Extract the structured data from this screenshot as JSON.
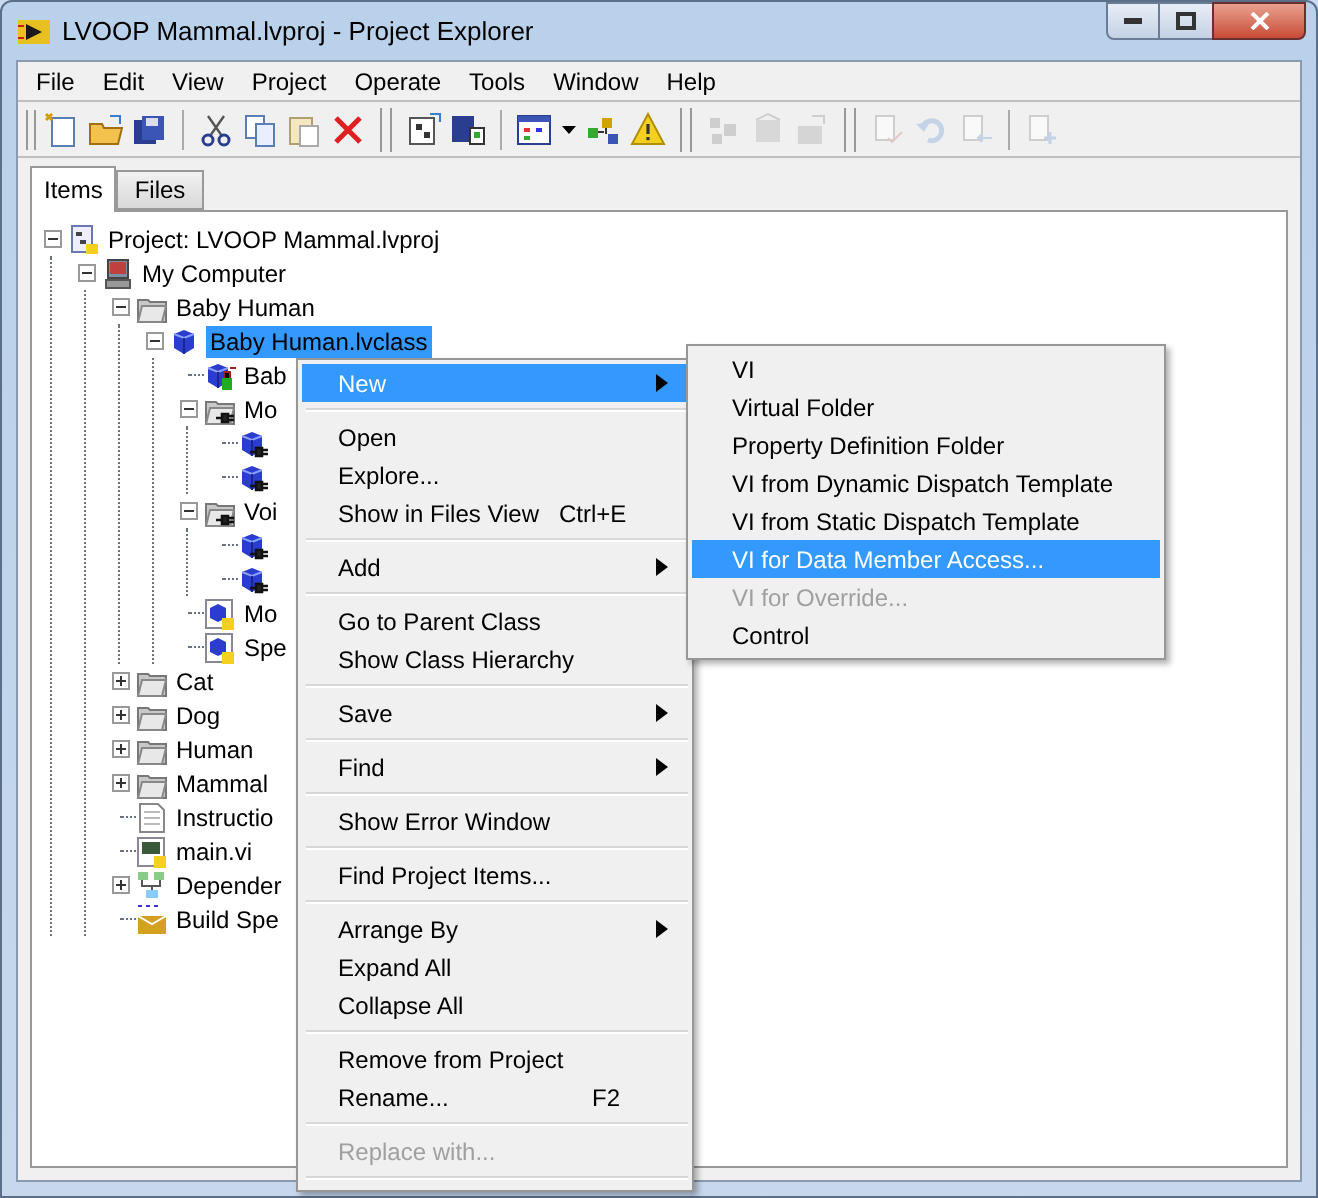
{
  "window": {
    "title": "LVOOP Mammal.lvproj - Project Explorer"
  },
  "menu_bar": [
    "File",
    "Edit",
    "View",
    "Project",
    "Operate",
    "Tools",
    "Window",
    "Help"
  ],
  "toolbar": [
    {
      "kind": "new",
      "disabled": false
    },
    {
      "kind": "open",
      "disabled": false
    },
    {
      "kind": "save-all",
      "disabled": false
    },
    {
      "kind": "separator"
    },
    {
      "kind": "cut",
      "disabled": false
    },
    {
      "kind": "copy",
      "disabled": false
    },
    {
      "kind": "paste",
      "disabled": false
    },
    {
      "kind": "delete",
      "disabled": false
    },
    {
      "kind": "group"
    },
    {
      "kind": "build",
      "disabled": false
    },
    {
      "kind": "save-build",
      "disabled": false
    },
    {
      "kind": "separator"
    },
    {
      "kind": "view",
      "disabled": false
    },
    {
      "kind": "dropdown",
      "disabled": false
    },
    {
      "kind": "hierarchy",
      "disabled": false
    },
    {
      "kind": "warning",
      "disabled": false
    },
    {
      "kind": "group"
    },
    {
      "kind": "source-control",
      "disabled": true
    },
    {
      "kind": "package",
      "disabled": true
    },
    {
      "kind": "package-out",
      "disabled": true
    },
    {
      "kind": "group"
    },
    {
      "kind": "check-in",
      "disabled": true
    },
    {
      "kind": "undo-checkout",
      "disabled": true
    },
    {
      "kind": "get",
      "disabled": true
    },
    {
      "kind": "separator"
    },
    {
      "kind": "add-file",
      "disabled": true
    }
  ],
  "tabs": [
    {
      "label": "Items",
      "selected": true
    },
    {
      "label": "Files",
      "selected": false
    }
  ],
  "tree": [
    {
      "kind": "project",
      "label": "Project: LVOOP Mammal.lvproj",
      "expanded": true,
      "selected": false,
      "children": [
        {
          "kind": "computer",
          "label": "My Computer",
          "expanded": true,
          "selected": false,
          "children": [
            {
              "kind": "folder",
              "label": "Baby Human",
              "expanded": true,
              "selected": false,
              "children": [
                {
                  "kind": "class",
                  "label": "Baby Human.lvclass",
                  "expanded": true,
                  "selected": true,
                  "children": [
                    {
                      "kind": "private-vi",
                      "label": "Bab",
                      "selected": false
                    },
                    {
                      "kind": "dispatch-folder",
                      "label": "Mo",
                      "expanded": true,
                      "selected": false,
                      "children": [
                        {
                          "kind": "dispatch-vi"
                        },
                        {
                          "kind": "dispatch-vi"
                        }
                      ]
                    },
                    {
                      "kind": "dispatch-folder",
                      "label": "Voi",
                      "expanded": true,
                      "selected": false,
                      "children": [
                        {
                          "kind": "dispatch-vi"
                        },
                        {
                          "kind": "dispatch-vi"
                        }
                      ]
                    },
                    {
                      "kind": "vi",
                      "label": "Mo",
                      "selected": false
                    },
                    {
                      "kind": "vi",
                      "label": "Spe",
                      "selected": false
                    }
                  ]
                }
              ]
            },
            {
              "kind": "folder",
              "label": "Cat",
              "expanded": false,
              "selected": false
            },
            {
              "kind": "folder",
              "label": "Dog",
              "expanded": false,
              "selected": false
            },
            {
              "kind": "folder",
              "label": "Human",
              "expanded": false,
              "selected": false
            },
            {
              "kind": "folder",
              "label": "Mammal",
              "expanded": false,
              "selected": false
            },
            {
              "kind": "text-file",
              "label": "Instructio",
              "selected": false
            },
            {
              "kind": "main-vi",
              "label": "main.vi",
              "selected": false
            },
            {
              "kind": "dependencies",
              "label": "Depender",
              "expanded": false,
              "selected": false
            },
            {
              "kind": "build",
              "label": "Build Spe",
              "selected": false
            }
          ]
        }
      ]
    }
  ],
  "context_menu": [
    {
      "kind": "item",
      "label": "New",
      "submenu": true,
      "selected": true,
      "disabled": false
    },
    {
      "kind": "separator"
    },
    {
      "kind": "item",
      "label": "Open",
      "selected": false,
      "disabled": false
    },
    {
      "kind": "item",
      "label": "Explore...",
      "selected": false,
      "disabled": false
    },
    {
      "kind": "item",
      "label": "Show in Files View",
      "shortcut": "Ctrl+E",
      "selected": false,
      "disabled": false
    },
    {
      "kind": "separator"
    },
    {
      "kind": "item",
      "label": "Add",
      "submenu": true,
      "selected": false,
      "disabled": false
    },
    {
      "kind": "separator"
    },
    {
      "kind": "item",
      "label": "Go to Parent Class",
      "selected": false,
      "disabled": false
    },
    {
      "kind": "item",
      "label": "Show Class Hierarchy",
      "selected": false,
      "disabled": false
    },
    {
      "kind": "separator"
    },
    {
      "kind": "item",
      "label": "Save",
      "submenu": true,
      "selected": false,
      "disabled": false
    },
    {
      "kind": "separator"
    },
    {
      "kind": "item",
      "label": "Find",
      "submenu": true,
      "selected": false,
      "disabled": false
    },
    {
      "kind": "separator"
    },
    {
      "kind": "item",
      "label": "Show Error Window",
      "selected": false,
      "disabled": false
    },
    {
      "kind": "separator"
    },
    {
      "kind": "item",
      "label": "Find Project Items...",
      "selected": false,
      "disabled": false
    },
    {
      "kind": "separator"
    },
    {
      "kind": "item",
      "label": "Arrange By",
      "submenu": true,
      "selected": false,
      "disabled": false
    },
    {
      "kind": "item",
      "label": "Expand All",
      "selected": false,
      "disabled": false
    },
    {
      "kind": "item",
      "label": "Collapse All",
      "selected": false,
      "disabled": false
    },
    {
      "kind": "separator"
    },
    {
      "kind": "item",
      "label": "Remove from Project",
      "selected": false,
      "disabled": false
    },
    {
      "kind": "item",
      "label": "Rename...",
      "shortcut": "F2",
      "selected": false,
      "disabled": false
    },
    {
      "kind": "separator"
    },
    {
      "kind": "item",
      "label": "Replace with...",
      "selected": false,
      "disabled": true
    },
    {
      "kind": "separator"
    }
  ],
  "submenu": [
    {
      "label": "VI",
      "selected": false,
      "disabled": false
    },
    {
      "label": "Virtual Folder",
      "selected": false,
      "disabled": false
    },
    {
      "label": "Property Definition Folder",
      "selected": false,
      "disabled": false
    },
    {
      "label": "VI from Dynamic Dispatch Template",
      "selected": false,
      "disabled": false
    },
    {
      "label": "VI from Static Dispatch Template",
      "selected": false,
      "disabled": false
    },
    {
      "label": "VI for Data Member Access...",
      "selected": true,
      "disabled": false
    },
    {
      "label": "VI for Override...",
      "selected": false,
      "disabled": true
    },
    {
      "label": "Control",
      "selected": false,
      "disabled": false
    }
  ]
}
